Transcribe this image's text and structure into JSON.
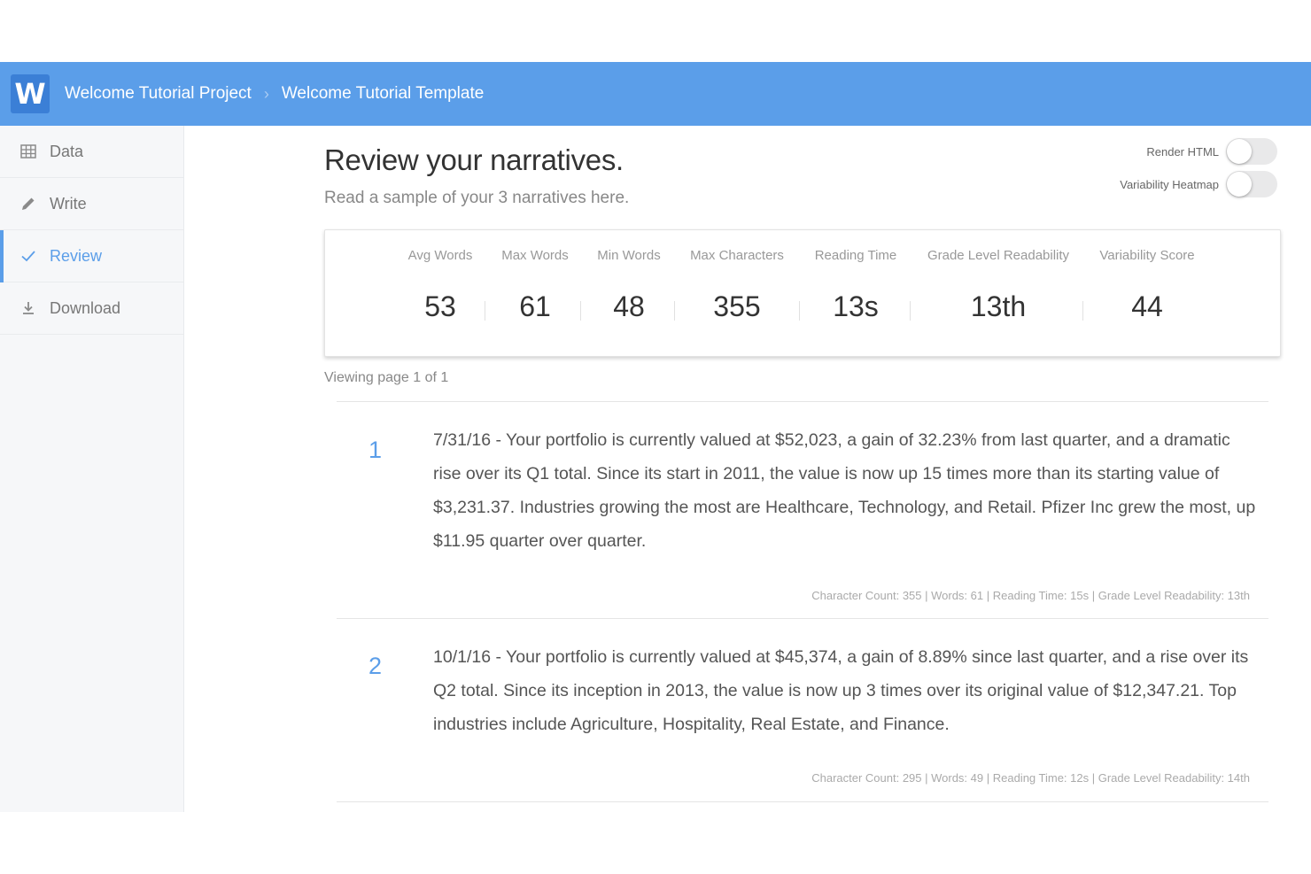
{
  "app": {
    "logo_letter": "W",
    "breadcrumb": [
      "Welcome Tutorial Project",
      "Welcome Tutorial Template"
    ],
    "breadcrumb_separator": "›",
    "accent_color": "#5b9ee9"
  },
  "sidebar": {
    "items": [
      {
        "label": "Data",
        "icon": "grid-icon",
        "active": false
      },
      {
        "label": "Write",
        "icon": "pencil-icon",
        "active": false
      },
      {
        "label": "Review",
        "icon": "check-icon",
        "active": true
      },
      {
        "label": "Download",
        "icon": "download-icon",
        "active": false
      }
    ]
  },
  "main": {
    "title": "Review your narratives.",
    "subtitle": "Read a sample of your 3 narratives here.",
    "toggles": [
      {
        "label": "Render HTML",
        "on": false
      },
      {
        "label": "Variability Heatmap",
        "on": false
      }
    ],
    "stats": [
      {
        "label": "Avg Words",
        "value": "53"
      },
      {
        "label": "Max Words",
        "value": "61"
      },
      {
        "label": "Min Words",
        "value": "48"
      },
      {
        "label": "Max Characters",
        "value": "355"
      },
      {
        "label": "Reading Time",
        "value": "13s"
      },
      {
        "label": "Grade Level Readability",
        "value": "13th"
      },
      {
        "label": "Variability Score",
        "value": "44"
      }
    ],
    "viewing": "Viewing page 1 of 1",
    "narratives": [
      {
        "number": "1",
        "text": "7/31/16 - Your portfolio is currently valued at $52,023, a gain of 32.23% from last quarter, and a dramatic rise over its Q1 total. Since its start in 2011, the value is now up 15 times more than its starting value of $3,231.37. Industries growing the most are Healthcare, Technology, and Retail. Pfizer Inc grew the most, up $11.95 quarter over quarter.",
        "meta": "Character Count: 355 | Words: 61 | Reading Time: 15s | Grade Level Readability: 13th"
      },
      {
        "number": "2",
        "text": "10/1/16 - Your portfolio is currently valued at $45,374, a gain of 8.89% since last quarter, and a rise over its Q2 total. Since its inception in 2013, the value is now up 3 times over its original value of $12,347.21. Top industries include Agriculture, Hospitality, Real Estate, and Finance.",
        "meta": "Character Count: 295 | Words: 49 | Reading Time: 12s | Grade Level Readability: 14th"
      }
    ]
  }
}
